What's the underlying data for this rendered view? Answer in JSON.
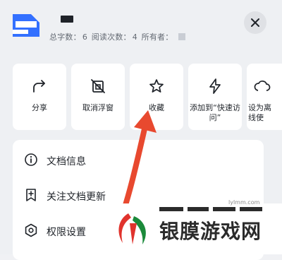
{
  "header": {
    "stats": {
      "word_count_label": "总字数：",
      "word_count": "6",
      "read_count_label": "阅读次数：",
      "read_count": "4",
      "owner_label": "所有者："
    },
    "close_icon": "close-icon"
  },
  "actions": [
    {
      "label": "分享",
      "icon": "share-icon"
    },
    {
      "label": "取消浮窗",
      "icon": "cancel-float-icon"
    },
    {
      "label": "收藏",
      "icon": "star-icon"
    },
    {
      "label": "添加到“快速访问”",
      "icon": "lightning-icon"
    },
    {
      "label": "设为离线使",
      "icon": "offline-icon"
    }
  ],
  "list": [
    {
      "label": "文档信息",
      "icon": "info-icon"
    },
    {
      "label": "关注文档更新",
      "icon": "follow-update-icon"
    },
    {
      "label": "权限设置",
      "icon": "settings-icon"
    }
  ],
  "watermark": {
    "brand": "银膜游戏网",
    "url": "lylmm.com"
  },
  "colors": {
    "arrow": "#e8492f",
    "accent": "#3370ff",
    "watermark_red": "#e0332d",
    "watermark_green": "#1b8a3a"
  }
}
